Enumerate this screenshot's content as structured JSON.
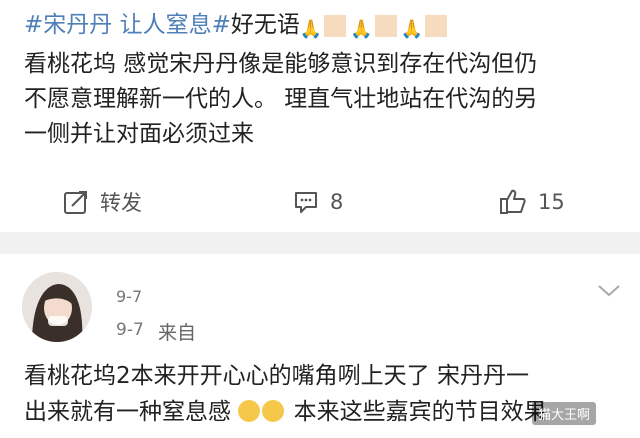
{
  "post": {
    "hashtag": "#宋丹丹 让人窒息#",
    "text_after_hashtag": "好无语",
    "line1": "看桃花坞 感觉宋丹丹像是能够意识到存在代沟但仍",
    "line2": "不愿意理解新一代的人。 理直气壮地站在代沟的另",
    "line3": "一侧并让对面必须过来"
  },
  "actions": {
    "repost_label": "转发",
    "comment_count": "8",
    "like_count": "15"
  },
  "comment": {
    "date": "9-7",
    "date2": "9-7",
    "source": "来自",
    "line1": "看桃花坞2本来开开心心的嘴角咧上天了 宋丹丹一",
    "line2_start": "出来就有一种窒息感",
    "line2_end": "本来这些嘉宾的节目效果"
  },
  "watermark": "猫大王啊",
  "colors": {
    "hashtag": "#4f7fb7",
    "divider": "#f1f1f1"
  }
}
